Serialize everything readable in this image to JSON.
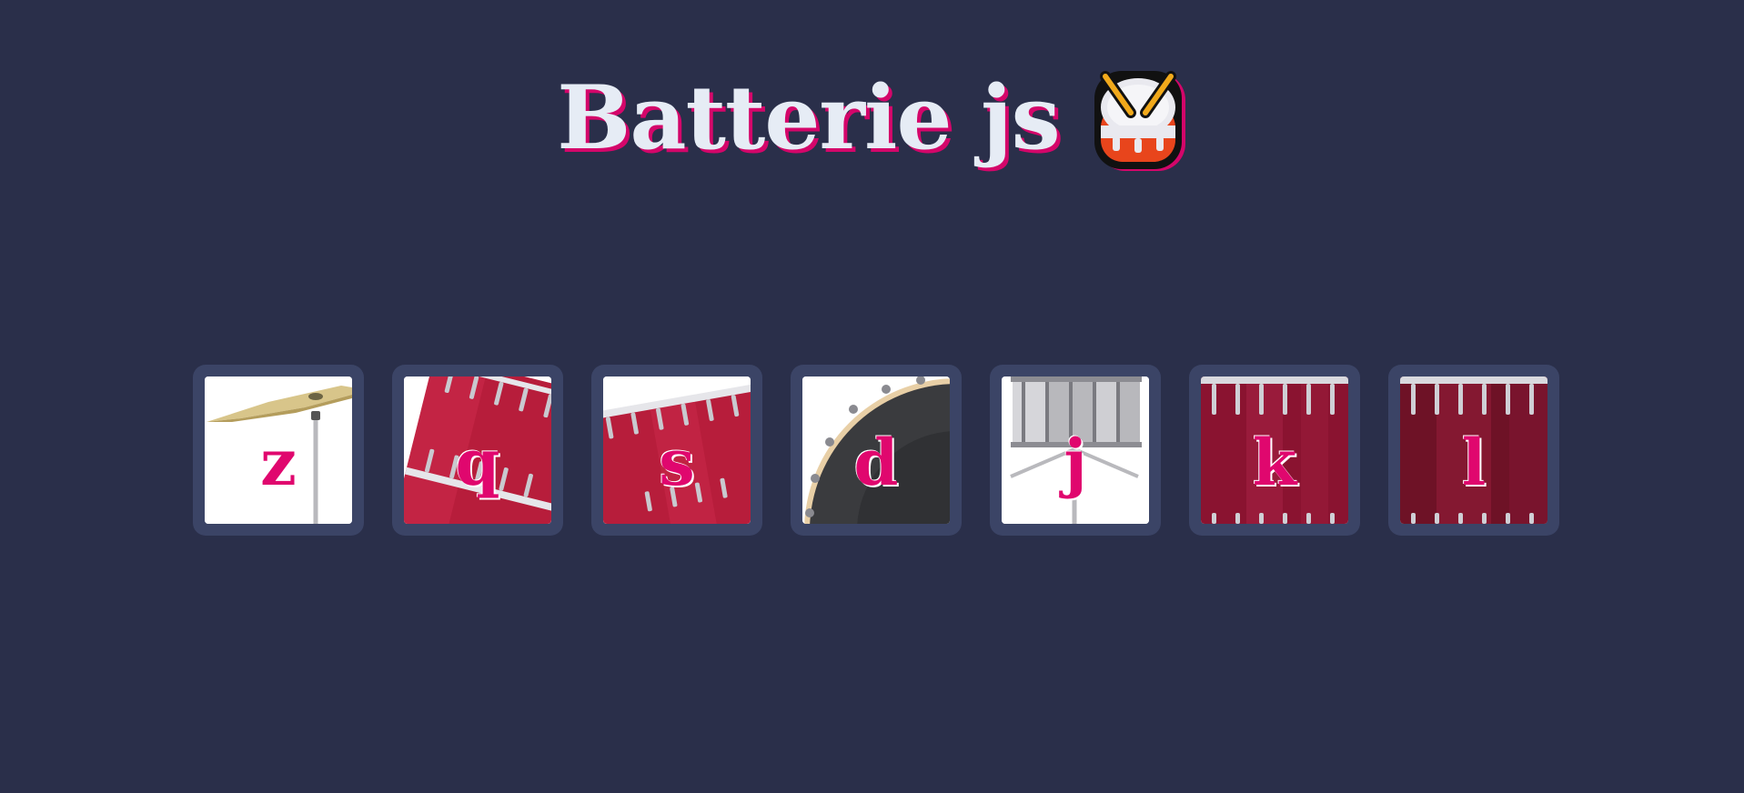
{
  "header": {
    "title": "Batterie js",
    "logo_icon": "drum-emoji-icon"
  },
  "pads": [
    {
      "key": "z",
      "instrument_icon": "cymbal-icon"
    },
    {
      "key": "q",
      "instrument_icon": "floor-tom-icon"
    },
    {
      "key": "s",
      "instrument_icon": "tom-icon"
    },
    {
      "key": "d",
      "instrument_icon": "bass-drum-icon"
    },
    {
      "key": "j",
      "instrument_icon": "snare-drum-icon"
    },
    {
      "key": "k",
      "instrument_icon": "drum-icon"
    },
    {
      "key": "l",
      "instrument_icon": "drum-icon"
    }
  ],
  "colors": {
    "background": "#2a2f4a",
    "pad_border": "#3b4466",
    "accent": "#e0076e",
    "title": "#e6ecf5"
  }
}
